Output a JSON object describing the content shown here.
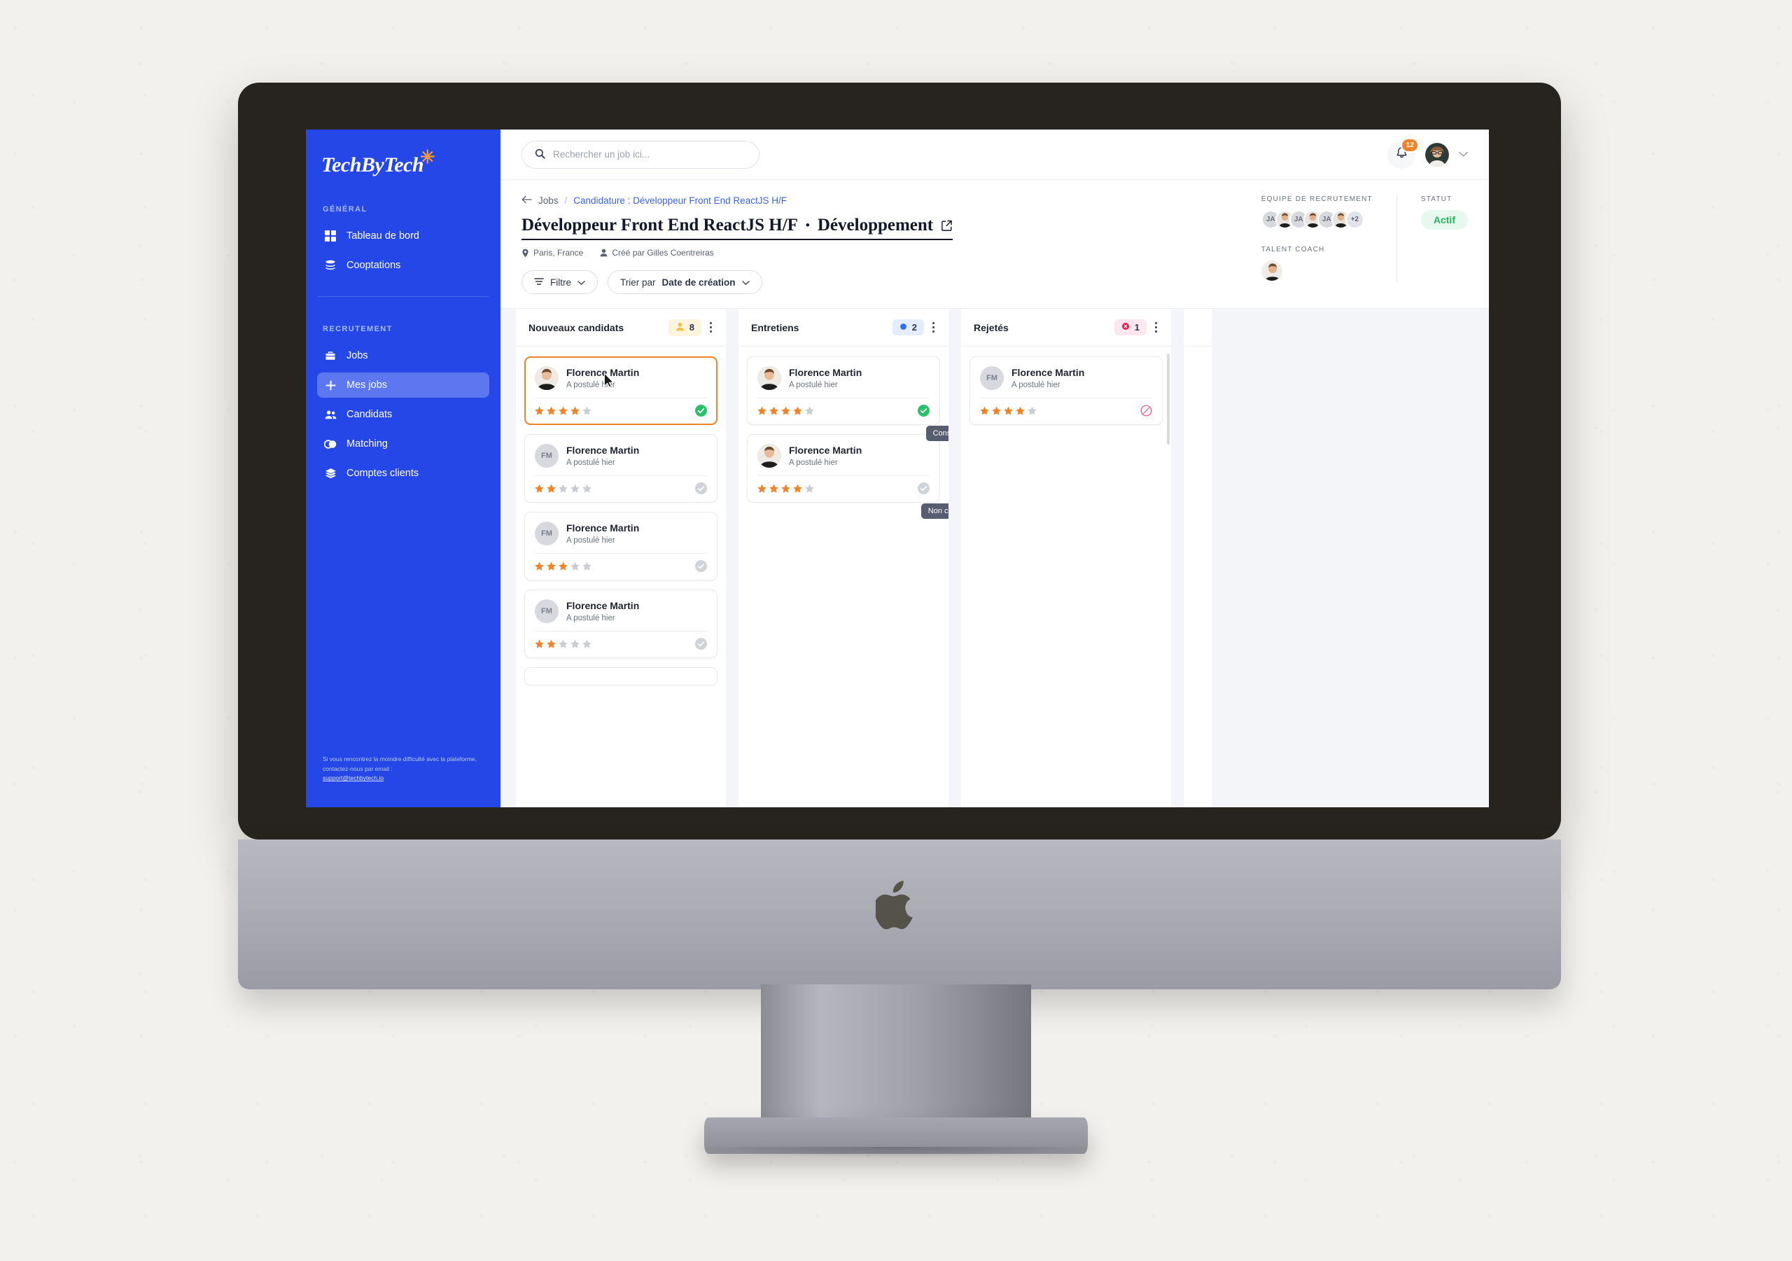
{
  "brand": {
    "name": "TechByTech",
    "accent": "#f79a33",
    "sidebar_bg": "#2547e8"
  },
  "sidebar": {
    "sections": [
      {
        "label": "GÉNÉRAL",
        "items": [
          {
            "label": "Tableau de bord",
            "icon": "grid-icon",
            "active": false
          },
          {
            "label": "Cooptations",
            "icon": "database-icon",
            "active": false
          }
        ]
      },
      {
        "label": "RECRUTEMENT",
        "items": [
          {
            "label": "Jobs",
            "icon": "briefcase-icon",
            "active": false
          },
          {
            "label": "Mes jobs",
            "icon": "plus-icon",
            "active": true
          },
          {
            "label": "Candidats",
            "icon": "users-icon",
            "active": false
          },
          {
            "label": "Matching",
            "icon": "matching-icon",
            "active": false
          },
          {
            "label": "Comptes clients",
            "icon": "layers-icon",
            "active": false
          }
        ]
      }
    ],
    "footer_text": "Si vous rencontrez la moindre difficulté avec la plateforme, contactez-nous par email :",
    "footer_email": "support@techbytech.io"
  },
  "topbar": {
    "search_placeholder": "Rechercher un job ici...",
    "search_value": "",
    "notifications_count": "12"
  },
  "breadcrumb": {
    "back_label": "Jobs",
    "separator": "/",
    "current": "Candidature : Développeur Front End ReactJS H/F"
  },
  "page": {
    "title": "Développeur Front End ReactJS H/F",
    "title_dot": "•",
    "title_suffix": "Développement",
    "location": "Paris, France",
    "creator": "Créé par Gilles Coentreiras"
  },
  "controls": {
    "filter_label": "Filtre",
    "sort_prefix": "Trier par",
    "sort_value": "Date de création"
  },
  "rightinfo": {
    "team_label": "ÉQUIPE DE RECRUTEMENT",
    "team_avatars": [
      "JA",
      "photo",
      "JA",
      "photo",
      "JA",
      "photo"
    ],
    "team_more": "+2",
    "coach_label": "TALENT COACH",
    "status_label": "STATUT",
    "status_value": "Actif",
    "status_color": "#22b35e"
  },
  "board": {
    "columns": [
      {
        "title": "Nouveaux candidats",
        "count": "8",
        "count_style": "yellow",
        "count_icon": "person-yellow-icon",
        "cards": [
          {
            "name": "Florence Martin",
            "sub": "A postulé hier",
            "avatar": "photo",
            "rating": 4,
            "max_rating": 5,
            "status": "consulted",
            "selected": true
          },
          {
            "name": "Florence Martin",
            "sub": "A postulé hier",
            "avatar": "FM",
            "rating": 2,
            "max_rating": 5,
            "status": "not-consulted",
            "selected": false
          },
          {
            "name": "Florence Martin",
            "sub": "A postulé hier",
            "avatar": "FM",
            "rating": 3,
            "max_rating": 5,
            "status": "not-consulted",
            "selected": false
          },
          {
            "name": "Florence Martin",
            "sub": "A postulé hier",
            "avatar": "FM",
            "rating": 2,
            "max_rating": 5,
            "status": "not-consulted",
            "selected": false
          }
        ]
      },
      {
        "title": "Entretiens",
        "count": "2",
        "count_style": "blue",
        "count_icon": "dot-blue-icon",
        "cards": [
          {
            "name": "Florence Martin",
            "sub": "A postulé hier",
            "avatar": "photo",
            "rating": 4,
            "max_rating": 5,
            "status": "consulted",
            "selected": false,
            "tooltip": "Consulté"
          },
          {
            "name": "Florence Martin",
            "sub": "A postulé hier",
            "avatar": "photo",
            "rating": 4,
            "max_rating": 5,
            "status": "not-consulted",
            "selected": false,
            "tooltip": "Non consulté"
          }
        ]
      },
      {
        "title": "Rejetés",
        "count": "1",
        "count_style": "red",
        "count_icon": "x-red-icon",
        "cards": [
          {
            "name": "Florence Martin",
            "sub": "A postulé hier",
            "avatar": "FM",
            "rating": 4,
            "max_rating": 5,
            "status": "rejected",
            "selected": false
          }
        ]
      }
    ]
  }
}
